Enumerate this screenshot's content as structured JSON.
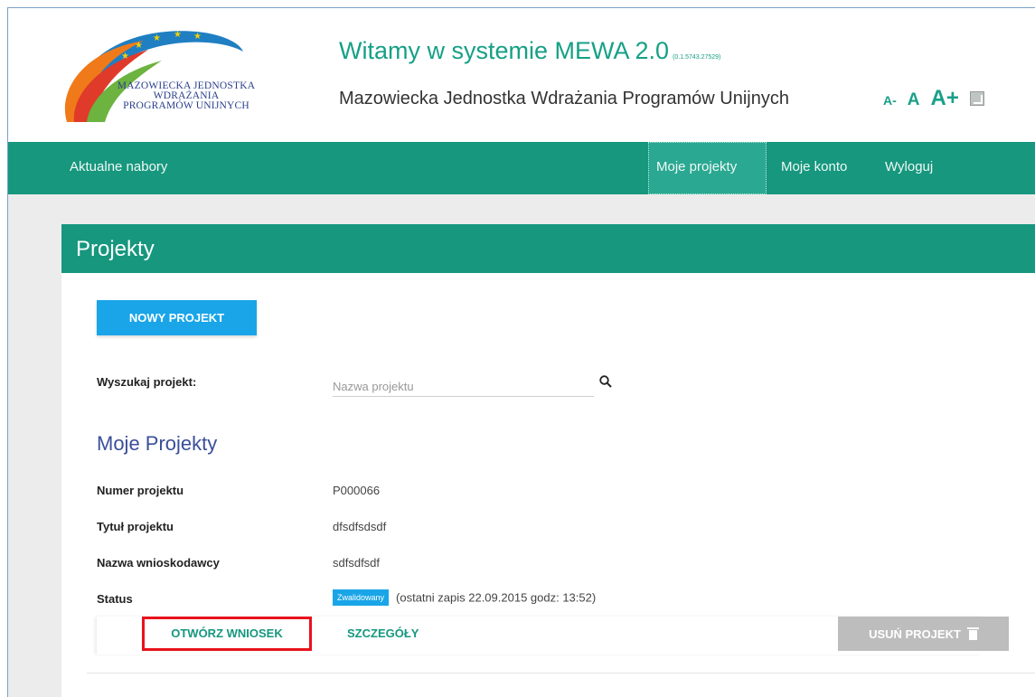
{
  "header": {
    "logo_lines": [
      "MAZOWIECKA JEDNOSTKA",
      "WDRAŻANIA",
      "PROGRAMÓW UNIJNYCH"
    ],
    "title": "Witamy w systemie MEWA 2.0",
    "version": "(0.1.5743.27529)",
    "subtitle": "Mazowiecka Jednostka Wdrażania Programów Unijnych",
    "font_controls": {
      "decrease": "A-",
      "normal": "A",
      "increase": "A+"
    },
    "contrast_icon": "contrast-icon"
  },
  "nav": {
    "left": "Aktualne nabory",
    "items": [
      {
        "label": "Moje projekty",
        "active": true
      },
      {
        "label": "Moje konto",
        "active": false
      },
      {
        "label": "Wyloguj",
        "active": false
      }
    ]
  },
  "panel": {
    "title": "Projekty",
    "new_project_button": "NOWY PROJEKT",
    "search": {
      "label": "Wyszukaj projekt:",
      "placeholder": "Nazwa projektu",
      "value": "",
      "icon": "search-icon"
    },
    "section_title": "Moje Projekty",
    "project": {
      "number_label": "Numer projektu",
      "number_value": "P000066",
      "title_label": "Tytuł projektu",
      "title_value": "dfsdfsdsdf",
      "applicant_label": "Nazwa wnioskodawcy",
      "applicant_value": "sdfsdfsdf",
      "status_label": "Status",
      "status_badge": "Zwalidowany",
      "status_note": "(ostatni zapis 22.09.2015  godz: 13:52)"
    },
    "actions": {
      "open": "OTWÓRZ WNIOSEK",
      "details": "SZCZEGÓŁY",
      "delete": "USUŃ PROJEKT",
      "delete_icon": "trash-icon"
    }
  },
  "colors": {
    "brand_green": "#16977e",
    "accent_blue": "#19a5e8",
    "highlight_red": "#e8121c",
    "section_blue": "#3a4f9a"
  }
}
